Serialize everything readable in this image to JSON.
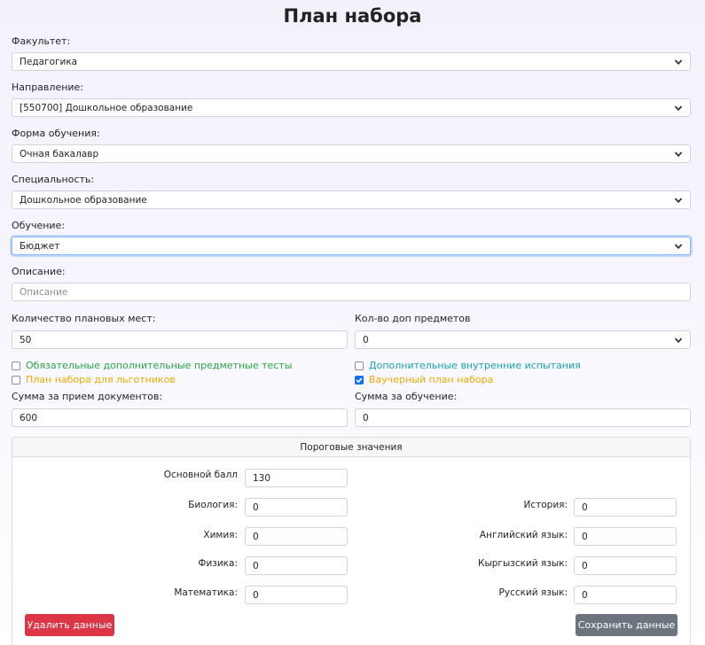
{
  "page": {
    "title": "План набора"
  },
  "form": {
    "faculty": {
      "label": "Факультет:",
      "value": "Педагогика"
    },
    "direction": {
      "label": "Направление:",
      "value": "[550700] Дошкольное образование"
    },
    "study_form": {
      "label": "Форма обучения:",
      "value": "Очная бакалавр"
    },
    "specialty": {
      "label": "Специальность:",
      "value": "Дошкольное образование"
    },
    "education": {
      "label": "Обучение:",
      "value": "Бюджет"
    },
    "description": {
      "label": "Описание:",
      "placeholder": "Описание"
    },
    "plan_places": {
      "label": "Количество плановых мест:",
      "value": "50"
    },
    "extra_subjects": {
      "label": "Кол-во доп предметов",
      "value": "0"
    },
    "checkboxes": {
      "required_tests": {
        "label": "Обязательные дополнительные предметные тесты",
        "checked": false,
        "color": "#28a745"
      },
      "internal_exams": {
        "label": "Дополнительные внутренние испытания",
        "checked": false,
        "color": "#17a2b8"
      },
      "benefit_plan": {
        "label": "План набора для льготников",
        "checked": false,
        "color": "#ffc107"
      },
      "voucher_plan": {
        "label": "Ваучерный план набора",
        "checked": true,
        "color": "#ffc107"
      }
    },
    "doc_fee": {
      "label": "Сумма за прием документов:",
      "value": "600"
    },
    "tuition_fee": {
      "label": "Сумма за обучение:",
      "value": "0"
    }
  },
  "thresholds": {
    "title": "Пороговые значения",
    "main_score": {
      "label": "Основной балл",
      "value": "130"
    },
    "biology": {
      "label": "Биология:",
      "value": "0"
    },
    "chemistry": {
      "label": "Химия:",
      "value": "0"
    },
    "physics": {
      "label": "Физика:",
      "value": "0"
    },
    "math": {
      "label": "Математика:",
      "value": "0"
    },
    "history": {
      "label": "История:",
      "value": "0"
    },
    "english": {
      "label": "Английский язык:",
      "value": "0"
    },
    "kyrgyz": {
      "label": "Кыргызский язык:",
      "value": "0"
    },
    "russian": {
      "label": "Русский язык:",
      "value": "0"
    }
  },
  "actions": {
    "delete_label": "Удалить данные",
    "save_label": "Сохранить данные",
    "delete_color": "#dc3545",
    "save_color": "#6c757d"
  },
  "icons": {
    "select": "chevron-down-icon",
    "check": "check-icon"
  }
}
